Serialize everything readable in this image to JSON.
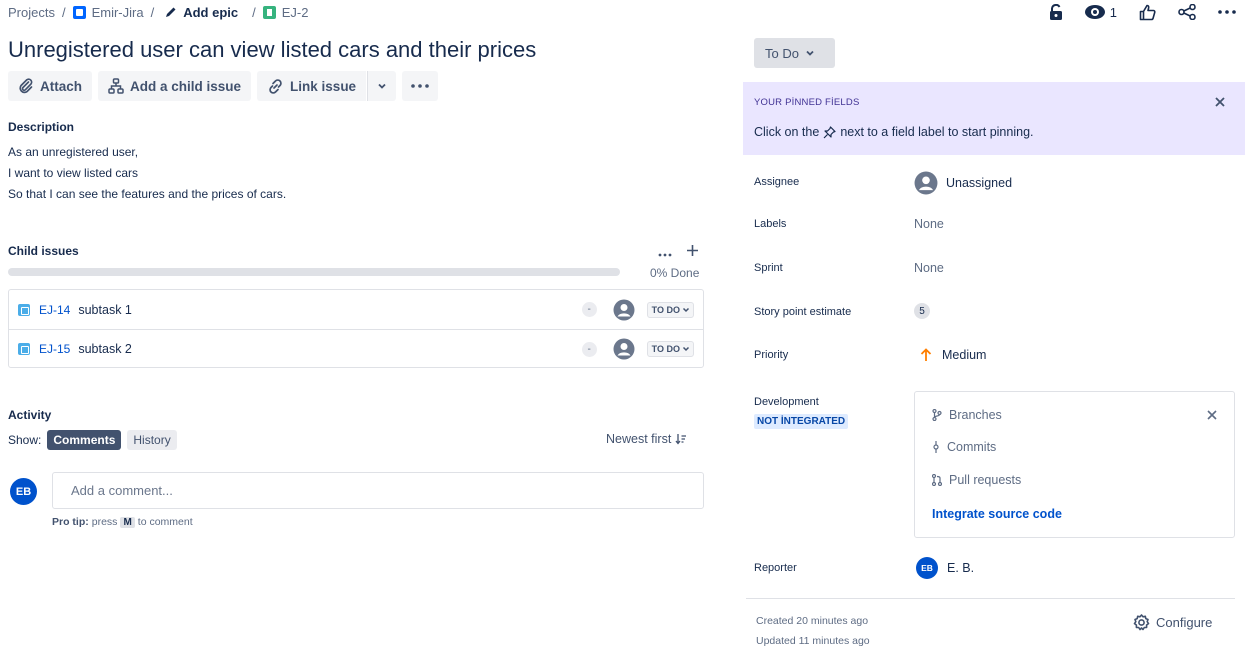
{
  "breadcrumb": {
    "projects": "Projects",
    "project": "Emir-Jira",
    "add_epic": "Add epic",
    "issue_key": "EJ-2"
  },
  "header": {
    "watch_count": "1"
  },
  "issue": {
    "title": "Unregistered user can view listed cars and their prices"
  },
  "toolbar": {
    "attach": "Attach",
    "add_child": "Add a child issue",
    "link_issue": "Link issue"
  },
  "description": {
    "heading": "Description",
    "lines": [
      "As an unregistered user,",
      "I want to view listed cars",
      "So that I can see the features and the prices of cars."
    ]
  },
  "child_issues": {
    "heading": "Child issues",
    "progress_fraction": 0,
    "progress_label": "0% Done",
    "items": [
      {
        "key": "EJ-14",
        "summary": "subtask 1",
        "priority": "-",
        "status": "TO DO"
      },
      {
        "key": "EJ-15",
        "summary": "subtask 2",
        "priority": "-",
        "status": "TO DO"
      }
    ]
  },
  "activity": {
    "heading": "Activity",
    "show_label": "Show:",
    "tabs": [
      "Comments",
      "History"
    ],
    "sort_label": "Newest first",
    "avatar_initials": "EB",
    "comment_placeholder": "Add a comment...",
    "protip_bold": "Pro tip:",
    "protip_press": "press",
    "protip_key": "M",
    "protip_rest": "to comment"
  },
  "sidebar": {
    "status": "To Do",
    "pinned": {
      "title": "YOUR PİNNED FİELDS",
      "text_before": "Click on the",
      "text_after": "next to a field label to start pinning."
    },
    "fields": {
      "assignee_label": "Assignee",
      "assignee_value": "Unassigned",
      "labels_label": "Labels",
      "labels_value": "None",
      "sprint_label": "Sprint",
      "sprint_value": "None",
      "story_points_label": "Story point estimate",
      "story_points_value": "5",
      "priority_label": "Priority",
      "priority_value": "Medium",
      "development_label": "Development",
      "development_badge": "NOT İNTEGRATED",
      "reporter_label": "Reporter",
      "reporter_initials": "EB",
      "reporter_value": "E. B."
    },
    "development": {
      "branches": "Branches",
      "commits": "Commits",
      "pull_requests": "Pull requests",
      "integrate_link": "Integrate source code"
    },
    "created": "Created 20 minutes ago",
    "updated": "Updated 11 minutes ago",
    "configure": "Configure"
  },
  "colors": {
    "accent": "#0052cc",
    "pinned_bg": "#eae6ff",
    "priority_medium": "#ff7f00"
  }
}
